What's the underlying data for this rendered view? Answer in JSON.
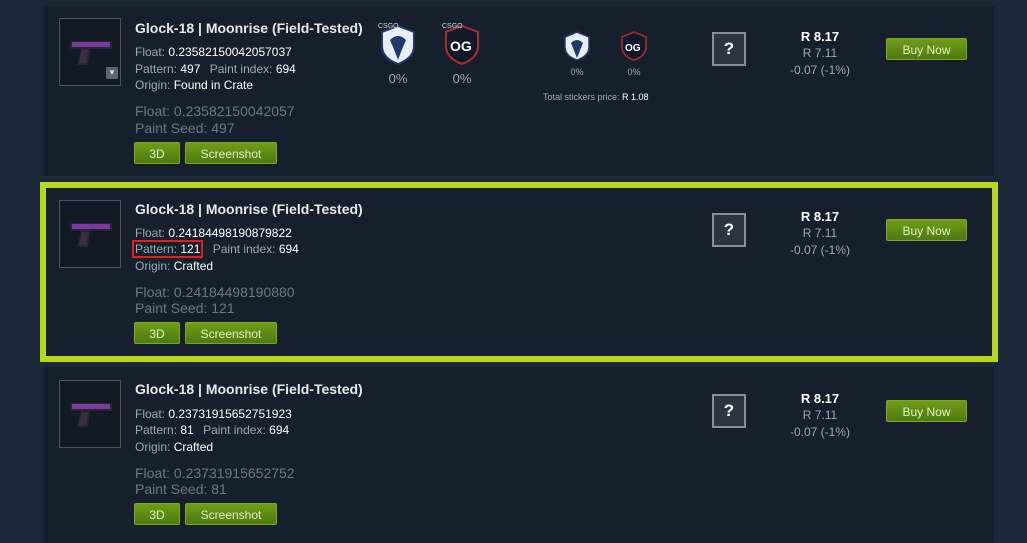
{
  "listings": [
    {
      "title": "Glock-18 | Moonrise (Field-Tested)",
      "float_label": "Float:",
      "float_value": "0.23582150042057037",
      "pattern_label": "Pattern:",
      "pattern_value": "497",
      "paint_label": "Paint index:",
      "paint_value": "694",
      "origin_label": "Origin:",
      "origin_value": "Found in Crate",
      "float_big": "Float: 0.23582150042057",
      "seed_big": "Paint Seed: 497",
      "btn_3d": "3D",
      "btn_screenshot": "Screenshot",
      "question": "?",
      "price_main": "R 8.17",
      "price_sub": "R 7.11",
      "price_change": "-0.07 (-1%)",
      "buy": "Buy Now",
      "stickers_large": [
        {
          "name": "Team Liquid sticker",
          "pct": "0%"
        },
        {
          "name": "OG sticker",
          "pct": "0%"
        }
      ],
      "stickers_small": [
        {
          "name": "Team Liquid sticker",
          "pct": "0%"
        },
        {
          "name": "OG sticker",
          "pct": "0%"
        }
      ],
      "sticker_tag": "CSGO",
      "total_label": "Total stickers price:",
      "total_value": "R 1.08"
    },
    {
      "title": "Glock-18 | Moonrise (Field-Tested)",
      "float_label": "Float:",
      "float_value": "0.24184498190879822",
      "pattern_label": "Pattern:",
      "pattern_value": "121",
      "paint_label": "Paint index:",
      "paint_value": "694",
      "origin_label": "Origin:",
      "origin_value": "Crafted",
      "float_big": "Float: 0.24184498190880",
      "seed_big": "Paint Seed: 121",
      "btn_3d": "3D",
      "btn_screenshot": "Screenshot",
      "question": "?",
      "price_main": "R 8.17",
      "price_sub": "R 7.11",
      "price_change": "-0.07 (-1%)",
      "buy": "Buy Now"
    },
    {
      "title": "Glock-18 | Moonrise (Field-Tested)",
      "float_label": "Float:",
      "float_value": "0.23731915652751923",
      "pattern_label": "Pattern:",
      "pattern_value": "81",
      "paint_label": "Paint index:",
      "paint_value": "694",
      "origin_label": "Origin:",
      "origin_value": "Crafted",
      "float_big": "Float: 0.23731915652752",
      "seed_big": "Paint Seed: 81",
      "btn_3d": "3D",
      "btn_screenshot": "Screenshot",
      "question": "?",
      "price_main": "R 8.17",
      "price_sub": "R 7.11",
      "price_change": "-0.07 (-1%)",
      "buy": "Buy Now"
    }
  ],
  "colors": {
    "background": "#1b2838",
    "highlight_frame": "#b8d81c",
    "pattern_box": "#e02020",
    "button_green": "#5c8a14"
  },
  "icons": {
    "thumbnail": "glock-pistol-icon",
    "dropdown": "chevron-down-icon",
    "unknown": "question-mark-icon"
  }
}
